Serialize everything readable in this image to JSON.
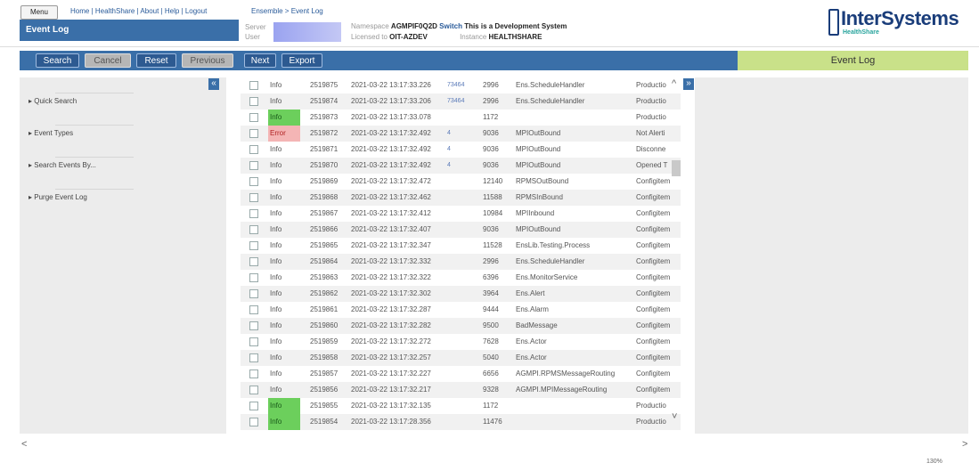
{
  "header": {
    "menu_label": "Menu",
    "links": "Home | HealthShare | About | Help | Logout",
    "page_title": "Event Log",
    "breadcrumb": "Ensemble > Event Log",
    "server_label": "Server",
    "user_label": "User",
    "namespace_label": "Namespace",
    "namespace_value": "AGMPIF0Q2D",
    "switch_label": "Switch",
    "dev_notice": "This is a Development System",
    "licensed_label": "Licensed to",
    "licensed_value": "OIT-AZDEV",
    "instance_label": "Instance",
    "instance_value": "HEALTHSHARE",
    "logo_text": "InterSystems",
    "logo_sub": "HealthShare"
  },
  "toolbar": {
    "search": "Search",
    "cancel": "Cancel",
    "reset": "Reset",
    "previous": "Previous",
    "next": "Next",
    "export": "Export"
  },
  "details_title": "Event Log",
  "left_panel": {
    "collapse_icon": "«",
    "items": [
      "▸ Quick Search",
      "▸ Event Types",
      "▸ Search Events By...",
      "▸ Purge Event Log"
    ]
  },
  "expand_icon": "»",
  "rows": [
    {
      "type": "Info",
      "id": "2519875",
      "time": "2021-03-22 13:17:33.226",
      "session": "73464",
      "job": "2996",
      "source": "Ens.ScheduleHandler",
      "text": "Productio"
    },
    {
      "type": "Info",
      "id": "2519874",
      "time": "2021-03-22 13:17:33.206",
      "session": "73464",
      "job": "2996",
      "source": "Ens.ScheduleHandler",
      "text": "Productio"
    },
    {
      "type": "Info",
      "id": "2519873",
      "time": "2021-03-22 13:17:33.078",
      "session": "",
      "job": "1172",
      "source": "",
      "text": "Productio",
      "hl": "info"
    },
    {
      "type": "Error",
      "id": "2519872",
      "time": "2021-03-22 13:17:32.492",
      "session": "4",
      "job": "9036",
      "source": "MPIOutBound",
      "text": "Not Alerti",
      "hl": "err"
    },
    {
      "type": "Info",
      "id": "2519871",
      "time": "2021-03-22 13:17:32.492",
      "session": "4",
      "job": "9036",
      "source": "MPIOutBound",
      "text": "Disconne"
    },
    {
      "type": "Info",
      "id": "2519870",
      "time": "2021-03-22 13:17:32.492",
      "session": "4",
      "job": "9036",
      "source": "MPIOutBound",
      "text": "Opened T"
    },
    {
      "type": "Info",
      "id": "2519869",
      "time": "2021-03-22 13:17:32.472",
      "session": "",
      "job": "12140",
      "source": "RPMSOutBound",
      "text": "Configitem"
    },
    {
      "type": "Info",
      "id": "2519868",
      "time": "2021-03-22 13:17:32.462",
      "session": "",
      "job": "11588",
      "source": "RPMSInBound",
      "text": "Configitem"
    },
    {
      "type": "Info",
      "id": "2519867",
      "time": "2021-03-22 13:17:32.412",
      "session": "",
      "job": "10984",
      "source": "MPIInbound",
      "text": "Configitem"
    },
    {
      "type": "Info",
      "id": "2519866",
      "time": "2021-03-22 13:17:32.407",
      "session": "",
      "job": "9036",
      "source": "MPIOutBound",
      "text": "Configitem"
    },
    {
      "type": "Info",
      "id": "2519865",
      "time": "2021-03-22 13:17:32.347",
      "session": "",
      "job": "11528",
      "source": "EnsLib.Testing.Process",
      "text": "Configitem"
    },
    {
      "type": "Info",
      "id": "2519864",
      "time": "2021-03-22 13:17:32.332",
      "session": "",
      "job": "2996",
      "source": "Ens.ScheduleHandler",
      "text": "Configitem"
    },
    {
      "type": "Info",
      "id": "2519863",
      "time": "2021-03-22 13:17:32.322",
      "session": "",
      "job": "6396",
      "source": "Ens.MonitorService",
      "text": "Configitem"
    },
    {
      "type": "Info",
      "id": "2519862",
      "time": "2021-03-22 13:17:32.302",
      "session": "",
      "job": "3964",
      "source": "Ens.Alert",
      "text": "Configitem"
    },
    {
      "type": "Info",
      "id": "2519861",
      "time": "2021-03-22 13:17:32.287",
      "session": "",
      "job": "9444",
      "source": "Ens.Alarm",
      "text": "Configitem"
    },
    {
      "type": "Info",
      "id": "2519860",
      "time": "2021-03-22 13:17:32.282",
      "session": "",
      "job": "9500",
      "source": "BadMessage",
      "text": "Configitem"
    },
    {
      "type": "Info",
      "id": "2519859",
      "time": "2021-03-22 13:17:32.272",
      "session": "",
      "job": "7628",
      "source": "Ens.Actor",
      "text": "Configitem"
    },
    {
      "type": "Info",
      "id": "2519858",
      "time": "2021-03-22 13:17:32.257",
      "session": "",
      "job": "5040",
      "source": "Ens.Actor",
      "text": "Configitem"
    },
    {
      "type": "Info",
      "id": "2519857",
      "time": "2021-03-22 13:17:32.227",
      "session": "",
      "job": "6656",
      "source": "AGMPI.RPMSMessageRouting",
      "text": "Configitem"
    },
    {
      "type": "Info",
      "id": "2519856",
      "time": "2021-03-22 13:17:32.217",
      "session": "",
      "job": "9328",
      "source": "AGMPI.MPIMessageRouting",
      "text": "Configitem"
    },
    {
      "type": "Info",
      "id": "2519855",
      "time": "2021-03-22 13:17:32.135",
      "session": "",
      "job": "1172",
      "source": "",
      "text": "Productio",
      "hl": "info"
    },
    {
      "type": "Info",
      "id": "2519854",
      "time": "2021-03-22 13:17:28.356",
      "session": "",
      "job": "11476",
      "source": "",
      "text": "Productio",
      "hl": "info"
    }
  ],
  "zoom": "130%",
  "colors": {
    "accent": "#3a6fa8",
    "details_header": "#c9e189",
    "info_highlight": "#6ccf5c",
    "error_highlight": "#f4b5b5"
  }
}
